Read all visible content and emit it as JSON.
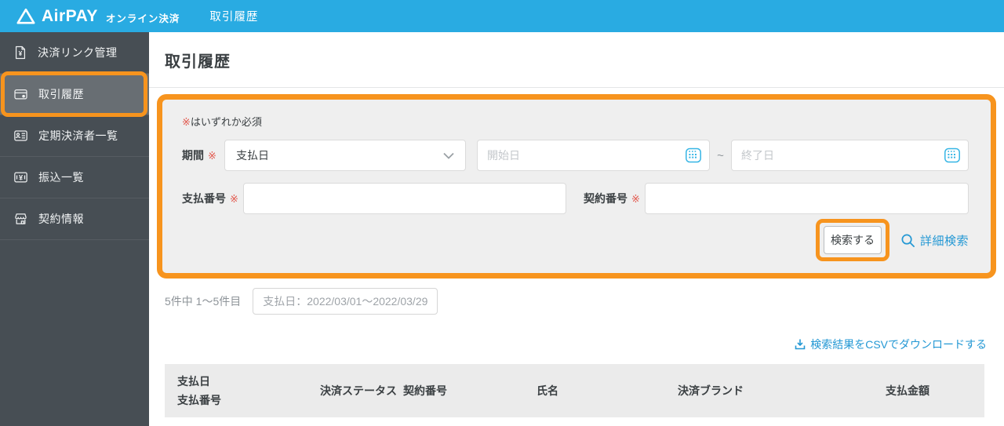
{
  "topbar": {
    "brand": "AirPAY",
    "brand_sub": "オンライン決済",
    "nav_item": "取引履歴"
  },
  "sidebar": {
    "items": [
      {
        "label": "決済リンク管理",
        "icon": "payment-link-icon",
        "active": false
      },
      {
        "label": "取引履歴",
        "icon": "credit-card-icon",
        "active": true
      },
      {
        "label": "定期決済者一覧",
        "icon": "subscriber-card-icon",
        "active": false
      },
      {
        "label": "振込一覧",
        "icon": "yen-note-icon",
        "active": false
      },
      {
        "label": "契約情報",
        "icon": "storefront-icon",
        "active": false
      }
    ]
  },
  "page": {
    "title": "取引履歴"
  },
  "search_form": {
    "required_note": {
      "mark": "※",
      "text": "はいずれか必須"
    },
    "period": {
      "label": "期間",
      "required_mark": "※",
      "selected": "支払日"
    },
    "start_date": {
      "placeholder": "開始日"
    },
    "end_date": {
      "placeholder": "終了日"
    },
    "range_separator": "~",
    "payment_number": {
      "label": "支払番号",
      "required_mark": "※",
      "value": ""
    },
    "contract_number": {
      "label": "契約番号",
      "required_mark": "※",
      "value": ""
    },
    "search_button": "検索する",
    "advanced_search": "詳細検索"
  },
  "results": {
    "count_text": "5件中 1〜5件目",
    "filter_badge": "支払日：2022/03/01〜2022/03/29",
    "csv_link": "検索結果をCSVでダウンロードする"
  },
  "table": {
    "headers": {
      "col1_line1": "支払日",
      "col1_line2": "支払番号",
      "col2": "決済ステータス",
      "col3": "契約番号",
      "col4": "氏名",
      "col5": "決済ブランド",
      "col6": "支払金額"
    }
  },
  "colors": {
    "topbar_blue": "#29ABE2",
    "annotation_orange": "#F7941E",
    "link_blue": "#2498D4",
    "required_red": "#E2574C",
    "sidebar_bg": "#474E54",
    "panel_bg": "#EFEFEF",
    "table_header_bg": "#EBEBEB"
  }
}
